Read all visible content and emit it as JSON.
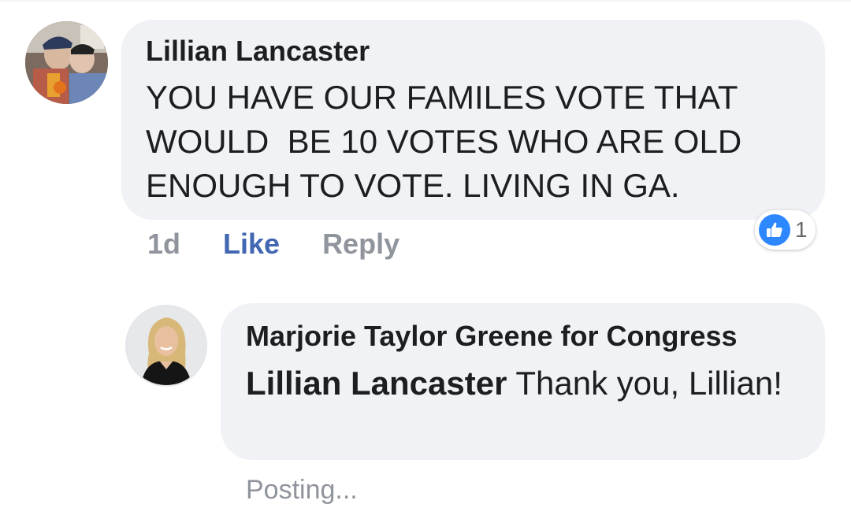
{
  "comments": [
    {
      "author": "Lillian Lancaster",
      "text": "YOU HAVE OUR FAMILES VOTE THAT\nWOULD  BE 10 VOTES WHO ARE OLD\nENOUGH TO VOTE. LIVING IN GA.",
      "time": "1d",
      "like_label": "Like",
      "reply_label": "Reply",
      "reaction": {
        "icon": "thumbs-up-icon",
        "count": "1"
      }
    }
  ],
  "reply": {
    "author": "Marjorie Taylor Greene for Congress",
    "mention": "Lillian Lancaster",
    "text": " Thank you, Lillian!",
    "status": "Posting..."
  },
  "colors": {
    "bubble": "#f0f2f5",
    "like_active": "#4267b2",
    "meta_gray": "#90949c",
    "reaction_blue": "#2d88ff"
  }
}
